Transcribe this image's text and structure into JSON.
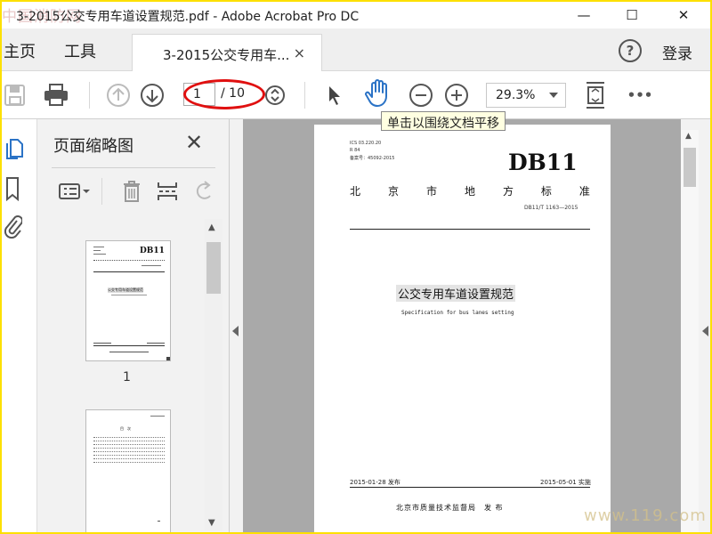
{
  "window": {
    "watermark": "中国消防网",
    "title": "3-2015公交专用车道设置规范.pdf - Adobe Acrobat Pro DC",
    "minimize": "—",
    "maximize": "☐",
    "close": "✕"
  },
  "menu": {
    "home": "主页",
    "tools": "工具",
    "tab_label": "3-2015公交专用车...",
    "tab_close": "×",
    "help": "?",
    "login": "登录"
  },
  "toolbar": {
    "page_current": "1",
    "page_total": "/ 10",
    "zoom": "29.3%",
    "more": "•••",
    "tooltip": "单击以围绕文档平移"
  },
  "thumbnail_panel": {
    "title": "页面缩略图",
    "close": "✕",
    "pages": [
      {
        "label": "1",
        "caption_db": "DB11",
        "caption_title": "公交专用车道设置规范"
      },
      {
        "label": "",
        "caption_db": "",
        "caption_title": "目　次"
      }
    ]
  },
  "document_page": {
    "ics": "ICS 03.220.20",
    "ccs": "R 84",
    "record": "备案号：45092-2015",
    "logo": "DB11",
    "standard_class": [
      "北",
      "京",
      "市",
      "地",
      "方",
      "标",
      "准"
    ],
    "standard_no": "DB11/T 1163—2015",
    "title": "公交专用车道设置规范",
    "subtitle": "Specification for bus lanes setting",
    "release_date": "2015-01-28 发布",
    "implement_date": "2015-05-01 实施",
    "publisher": "北京市质量技术监督局　发 布"
  },
  "bottom_watermark": "www.119.com",
  "colors": {
    "frame": "#fde000",
    "highlight_oval": "#e01010",
    "tooltip_bg": "#ffffe1",
    "hand_icon": "#2b73c6",
    "viewport_bg": "#a9a9a9"
  }
}
